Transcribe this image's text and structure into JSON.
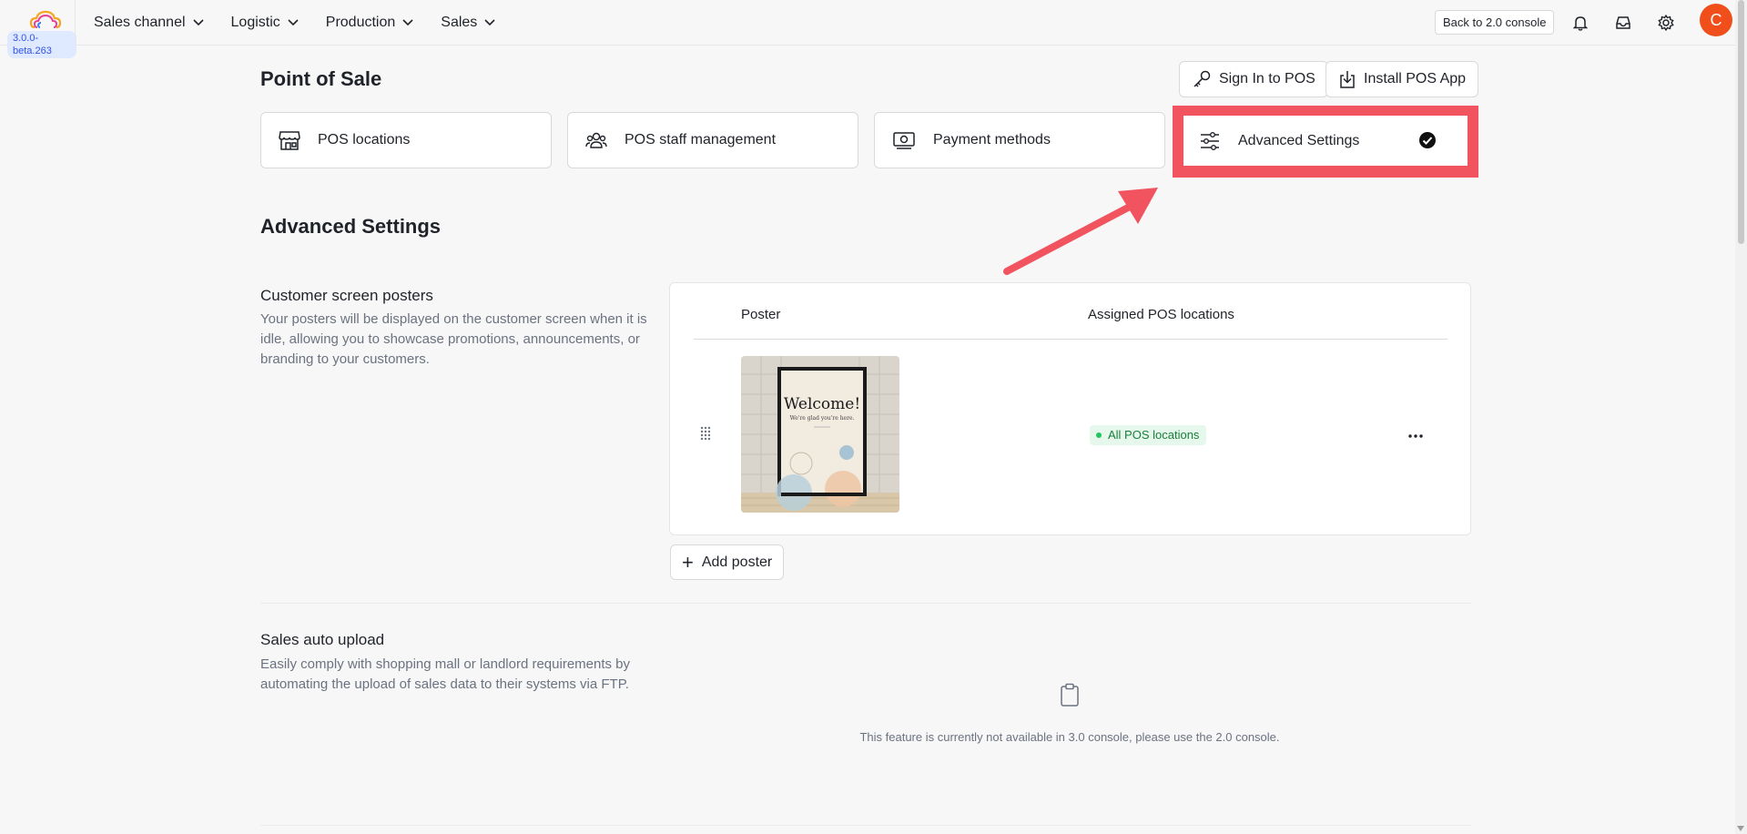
{
  "app": {
    "version": "3.0.0-beta.263",
    "back_button": "Back to 2.0 console",
    "avatar_initial": "C",
    "avatar_color": "#f04e1a"
  },
  "nav": {
    "items": [
      {
        "label": "Sales channel"
      },
      {
        "label": "Logistic"
      },
      {
        "label": "Production"
      },
      {
        "label": "Sales"
      }
    ]
  },
  "icons": [
    "bell-icon",
    "inbox-icon",
    "gear-icon",
    "key-icon",
    "download-icon",
    "store-icon",
    "staff-icon",
    "payment-icon",
    "sliders-icon",
    "check-icon",
    "drag-handle-icon",
    "more-icon",
    "plus-icon",
    "clipboard-icon"
  ],
  "page": {
    "title": "Point of Sale",
    "sign_in_button": "Sign In to POS",
    "install_button": "Install POS App"
  },
  "tabs": [
    {
      "label": "POS locations"
    },
    {
      "label": "POS staff management"
    },
    {
      "label": "Payment methods"
    },
    {
      "label": "Advanced Settings",
      "active": true
    }
  ],
  "advanced": {
    "title": "Advanced Settings",
    "posters": {
      "title": "Customer screen posters",
      "description": "Your posters will be displayed on the customer screen when it is idle, allowing you to showcase promotions, announcements, or branding to your customers.",
      "columns": {
        "poster": "Poster",
        "locations": "Assigned POS locations"
      },
      "rows": [
        {
          "poster_heading": "Welcome!",
          "poster_subtext": "We're glad you're here.",
          "location_tag": "All POS locations"
        }
      ],
      "add_button": "Add poster"
    },
    "sales_upload": {
      "title": "Sales auto upload",
      "description": "Easily comply with shopping mall or landlord requirements by automating the upload of sales data to their systems via FTP.",
      "unavailable_message": "This feature is currently not available in 3.0 console, please use the 2.0 console."
    }
  },
  "colors": {
    "highlight": "#f1545e",
    "tag_bg": "#e6f7ec",
    "tag_text": "#1a7f3a",
    "version_badge": "#2f54eb"
  }
}
